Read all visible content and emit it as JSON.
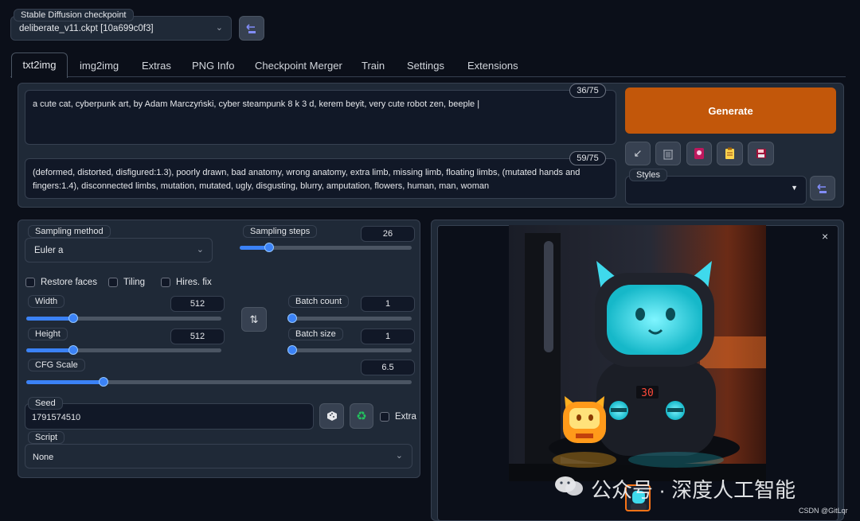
{
  "checkpoint": {
    "label": "Stable Diffusion checkpoint",
    "value": "deliberate_v11.ckpt [10a699c0f3]"
  },
  "tabs": [
    "txt2img",
    "img2img",
    "Extras",
    "PNG Info",
    "Checkpoint Merger",
    "Train",
    "Settings",
    "Extensions"
  ],
  "prompt": {
    "text": "a cute cat, cyberpunk art, by Adam Marczyński, cyber steampunk 8 k 3 d, kerem beyit, very cute robot zen, beeple |",
    "token_count": "36/75"
  },
  "negative_prompt": {
    "text": "(deformed, distorted, disfigured:1.3), poorly drawn, bad anatomy, wrong anatomy, extra limb, missing limb, floating limbs, (mutated hands and fingers:1.4), disconnected limbs, mutation, mutated, ugly, disgusting, blurry, amputation, flowers, human, man, woman",
    "token_count": "59/75"
  },
  "generate_label": "Generate",
  "styles_label": "Styles",
  "sampling": {
    "method_label": "Sampling method",
    "method_value": "Euler a",
    "steps_label": "Sampling steps",
    "steps_value": "26",
    "steps_fraction": 0.17
  },
  "checkboxes": {
    "restore_faces": "Restore faces",
    "tiling": "Tiling",
    "hires_fix": "Hires. fix"
  },
  "width": {
    "label": "Width",
    "value": "512",
    "fraction": 0.24
  },
  "height": {
    "label": "Height",
    "value": "512",
    "fraction": 0.24
  },
  "batch_count": {
    "label": "Batch count",
    "value": "1",
    "fraction": 0.0
  },
  "batch_size": {
    "label": "Batch size",
    "value": "1",
    "fraction": 0.0
  },
  "cfg": {
    "label": "CFG Scale",
    "value": "6.5",
    "fraction": 0.2
  },
  "seed": {
    "label": "Seed",
    "value": "1791574510",
    "extra_label": "Extra"
  },
  "script": {
    "label": "Script",
    "value": "None"
  },
  "output": {
    "robot_display": "30",
    "watermark": "公众号 · 深度人工智能",
    "credit": "CSDN @GitLqr"
  },
  "icons": [
    "refresh-checkpoint-icon",
    "arrow-icon",
    "trash-icon",
    "art-icon",
    "clipboard-icon",
    "save-icon",
    "swap-icon",
    "dice-icon",
    "recycle-icon",
    "close-icon",
    "chevron-down-icon"
  ]
}
